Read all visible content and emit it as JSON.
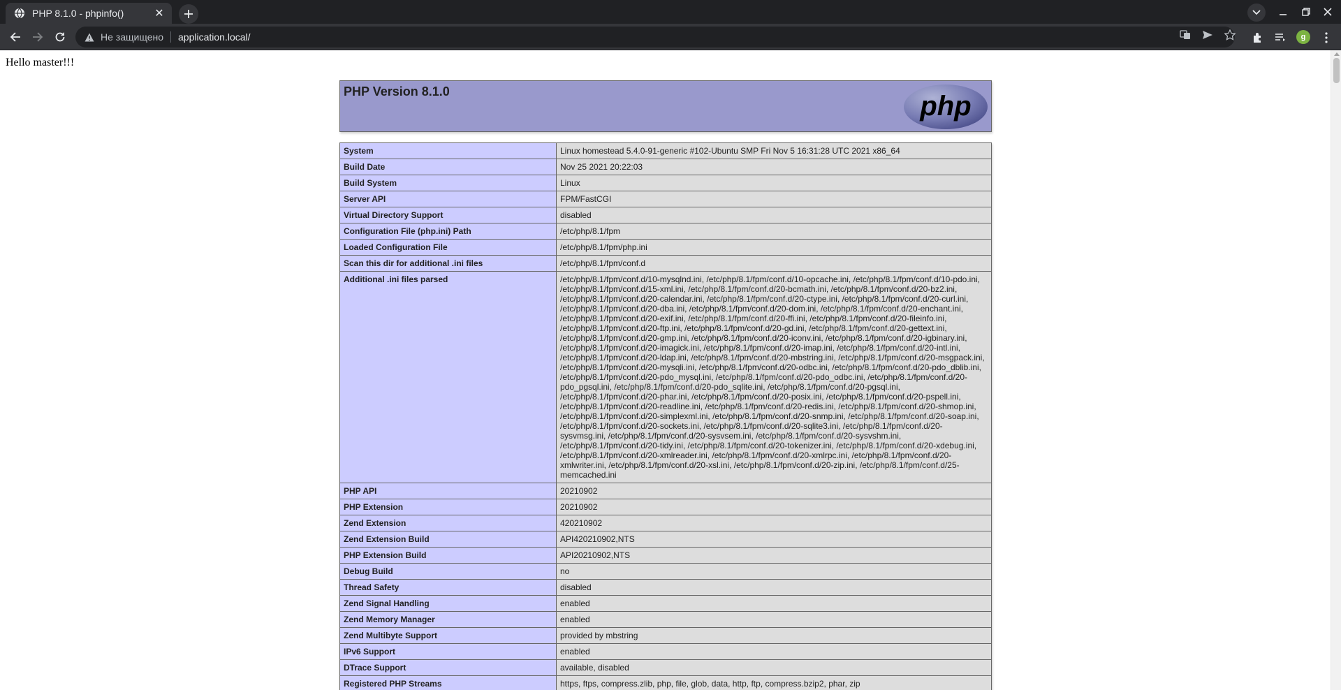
{
  "browser": {
    "tab_title": "PHP 8.1.0 - phpinfo()",
    "insecure_label": "Не защищено",
    "url": "application.local/",
    "avatar_letter": "g"
  },
  "page": {
    "hello": "Hello master!!!",
    "php_version": "PHP Version 8.1.0",
    "logo_text": "php"
  },
  "rows": [
    {
      "label": "System",
      "value": "Linux homestead 5.4.0-91-generic #102-Ubuntu SMP Fri Nov 5 16:31:28 UTC 2021 x86_64"
    },
    {
      "label": "Build Date",
      "value": "Nov 25 2021 20:22:03"
    },
    {
      "label": "Build System",
      "value": "Linux"
    },
    {
      "label": "Server API",
      "value": "FPM/FastCGI"
    },
    {
      "label": "Virtual Directory Support",
      "value": "disabled"
    },
    {
      "label": "Configuration File (php.ini) Path",
      "value": "/etc/php/8.1/fpm"
    },
    {
      "label": "Loaded Configuration File",
      "value": "/etc/php/8.1/fpm/php.ini"
    },
    {
      "label": "Scan this dir for additional .ini files",
      "value": "/etc/php/8.1/fpm/conf.d"
    },
    {
      "label": "Additional .ini files parsed",
      "value": "/etc/php/8.1/fpm/conf.d/10-mysqlnd.ini, /etc/php/8.1/fpm/conf.d/10-opcache.ini, /etc/php/8.1/fpm/conf.d/10-pdo.ini, /etc/php/8.1/fpm/conf.d/15-xml.ini, /etc/php/8.1/fpm/conf.d/20-bcmath.ini, /etc/php/8.1/fpm/conf.d/20-bz2.ini, /etc/php/8.1/fpm/conf.d/20-calendar.ini, /etc/php/8.1/fpm/conf.d/20-ctype.ini, /etc/php/8.1/fpm/conf.d/20-curl.ini, /etc/php/8.1/fpm/conf.d/20-dba.ini, /etc/php/8.1/fpm/conf.d/20-dom.ini, /etc/php/8.1/fpm/conf.d/20-enchant.ini, /etc/php/8.1/fpm/conf.d/20-exif.ini, /etc/php/8.1/fpm/conf.d/20-ffi.ini, /etc/php/8.1/fpm/conf.d/20-fileinfo.ini, /etc/php/8.1/fpm/conf.d/20-ftp.ini, /etc/php/8.1/fpm/conf.d/20-gd.ini, /etc/php/8.1/fpm/conf.d/20-gettext.ini, /etc/php/8.1/fpm/conf.d/20-gmp.ini, /etc/php/8.1/fpm/conf.d/20-iconv.ini, /etc/php/8.1/fpm/conf.d/20-igbinary.ini, /etc/php/8.1/fpm/conf.d/20-imagick.ini, /etc/php/8.1/fpm/conf.d/20-imap.ini, /etc/php/8.1/fpm/conf.d/20-intl.ini, /etc/php/8.1/fpm/conf.d/20-ldap.ini, /etc/php/8.1/fpm/conf.d/20-mbstring.ini, /etc/php/8.1/fpm/conf.d/20-msgpack.ini, /etc/php/8.1/fpm/conf.d/20-mysqli.ini, /etc/php/8.1/fpm/conf.d/20-odbc.ini, /etc/php/8.1/fpm/conf.d/20-pdo_dblib.ini, /etc/php/8.1/fpm/conf.d/20-pdo_mysql.ini, /etc/php/8.1/fpm/conf.d/20-pdo_odbc.ini, /etc/php/8.1/fpm/conf.d/20-pdo_pgsql.ini, /etc/php/8.1/fpm/conf.d/20-pdo_sqlite.ini, /etc/php/8.1/fpm/conf.d/20-pgsql.ini, /etc/php/8.1/fpm/conf.d/20-phar.ini, /etc/php/8.1/fpm/conf.d/20-posix.ini, /etc/php/8.1/fpm/conf.d/20-pspell.ini, /etc/php/8.1/fpm/conf.d/20-readline.ini, /etc/php/8.1/fpm/conf.d/20-redis.ini, /etc/php/8.1/fpm/conf.d/20-shmop.ini, /etc/php/8.1/fpm/conf.d/20-simplexml.ini, /etc/php/8.1/fpm/conf.d/20-snmp.ini, /etc/php/8.1/fpm/conf.d/20-soap.ini, /etc/php/8.1/fpm/conf.d/20-sockets.ini, /etc/php/8.1/fpm/conf.d/20-sqlite3.ini, /etc/php/8.1/fpm/conf.d/20-sysvmsg.ini, /etc/php/8.1/fpm/conf.d/20-sysvsem.ini, /etc/php/8.1/fpm/conf.d/20-sysvshm.ini, /etc/php/8.1/fpm/conf.d/20-tidy.ini, /etc/php/8.1/fpm/conf.d/20-tokenizer.ini, /etc/php/8.1/fpm/conf.d/20-xdebug.ini, /etc/php/8.1/fpm/conf.d/20-xmlreader.ini, /etc/php/8.1/fpm/conf.d/20-xmlrpc.ini, /etc/php/8.1/fpm/conf.d/20-xmlwriter.ini, /etc/php/8.1/fpm/conf.d/20-xsl.ini, /etc/php/8.1/fpm/conf.d/20-zip.ini, /etc/php/8.1/fpm/conf.d/25-memcached.ini"
    },
    {
      "label": "PHP API",
      "value": "20210902"
    },
    {
      "label": "PHP Extension",
      "value": "20210902"
    },
    {
      "label": "Zend Extension",
      "value": "420210902"
    },
    {
      "label": "Zend Extension Build",
      "value": "API420210902,NTS"
    },
    {
      "label": "PHP Extension Build",
      "value": "API20210902,NTS"
    },
    {
      "label": "Debug Build",
      "value": "no"
    },
    {
      "label": "Thread Safety",
      "value": "disabled"
    },
    {
      "label": "Zend Signal Handling",
      "value": "enabled"
    },
    {
      "label": "Zend Memory Manager",
      "value": "enabled"
    },
    {
      "label": "Zend Multibyte Support",
      "value": "provided by mbstring"
    },
    {
      "label": "IPv6 Support",
      "value": "enabled"
    },
    {
      "label": "DTrace Support",
      "value": "available, disabled"
    },
    {
      "label": "Registered PHP Streams",
      "value": "https, ftps, compress.zlib, php, file, glob, data, http, ftp, compress.bzip2, phar, zip"
    }
  ]
}
